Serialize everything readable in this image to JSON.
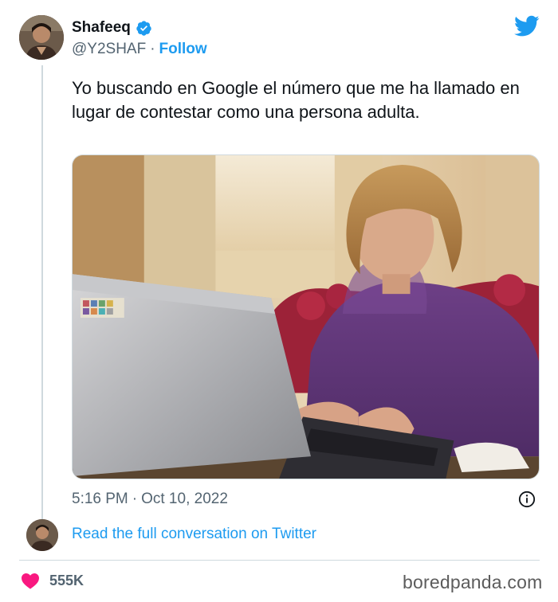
{
  "author": {
    "display_name": "Shafeeq",
    "handle": "@Y2SHAF",
    "separator": "·",
    "follow_label": "Follow"
  },
  "tweet": {
    "text": "Yo buscando en Google el número que me ha llamado en lugar de contestar como una persona adulta.",
    "media_alt": "Woman in a purple sweater looking intently at a laptop screen",
    "time": "5:16 PM",
    "date_separator": "·",
    "date": "Oct 10, 2022"
  },
  "conversation": {
    "link_label": "Read the full conversation on Twitter"
  },
  "engagement": {
    "likes": "555K"
  },
  "watermark": "boredpanda.com",
  "icons": {
    "verified": "verified-badge-icon",
    "brand": "twitter-bird-icon",
    "info": "info-icon",
    "like": "heart-icon"
  },
  "colors": {
    "accent": "#1d9bf0",
    "text": "#0f1419",
    "secondary": "#536471",
    "heart": "#f91880",
    "border": "#cfd9de"
  }
}
